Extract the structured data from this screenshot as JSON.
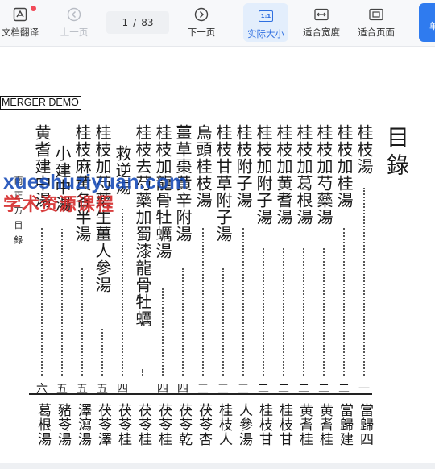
{
  "toolbar": {
    "translate_label": "文档翻译",
    "prev_label": "上一页",
    "page_current": "1",
    "page_separator": "/",
    "page_total": "83",
    "next_label": "下一页",
    "actual_size_label": "实际大小",
    "actual_size_icon_text": "1:1",
    "fit_width_label": "适合宽度",
    "fit_page_label": "适合页面",
    "edge_button_text": "单"
  },
  "document": {
    "merger_label": "MERGER DEMO",
    "title": "目錄",
    "entries": [
      {
        "name": "桂枝湯",
        "page": "一"
      },
      {
        "name": "桂枝加桂湯",
        "page": "二"
      },
      {
        "name": "桂枝加芍藥湯",
        "page": "二"
      },
      {
        "name": "桂枝加葛根湯",
        "page": "二"
      },
      {
        "name": "桂枝加黄耆湯",
        "page": "二"
      },
      {
        "name": "桂枝加附子湯",
        "page": "二"
      },
      {
        "name": "桂枝附子湯",
        "page": "三"
      },
      {
        "name": "桂枝甘草附子湯",
        "page": "三"
      },
      {
        "name": "烏頭桂枝湯",
        "page": "三"
      },
      {
        "name": "薑草棗黄辛附湯",
        "page": "四"
      },
      {
        "name": "桂枝加龍骨牡蠣湯",
        "page": "四"
      },
      {
        "name": "桂枝去芍藥加蜀漆龍骨牡蠣",
        "page": ""
      },
      {
        "name": "救逆湯",
        "page": "四"
      },
      {
        "name": "桂枝加芍藥生薑人參湯",
        "page": "五"
      },
      {
        "name": "桂枝麻黄各半湯",
        "page": "五"
      },
      {
        "name": "小建中湯",
        "page": "五"
      },
      {
        "name": "黄耆建中湯",
        "page": "六"
      }
    ],
    "side_note": "南 正 方 目 錄",
    "bottom_entries": [
      "當歸四",
      "當歸建",
      "黄耆桂",
      "黄耆桂",
      "桂枝甘",
      "桂枝甘",
      "人參湯",
      "桂枝人",
      "茯苓杏",
      "茯苓乾",
      "茯苓桂",
      "茯苓桂",
      "茯苓桂",
      "茯苓澤",
      "澤瀉湯",
      "豬苓湯",
      "葛根湯"
    ]
  },
  "watermark": {
    "line1": "xueshuziyuan.com",
    "line2": "学术资源课程"
  }
}
